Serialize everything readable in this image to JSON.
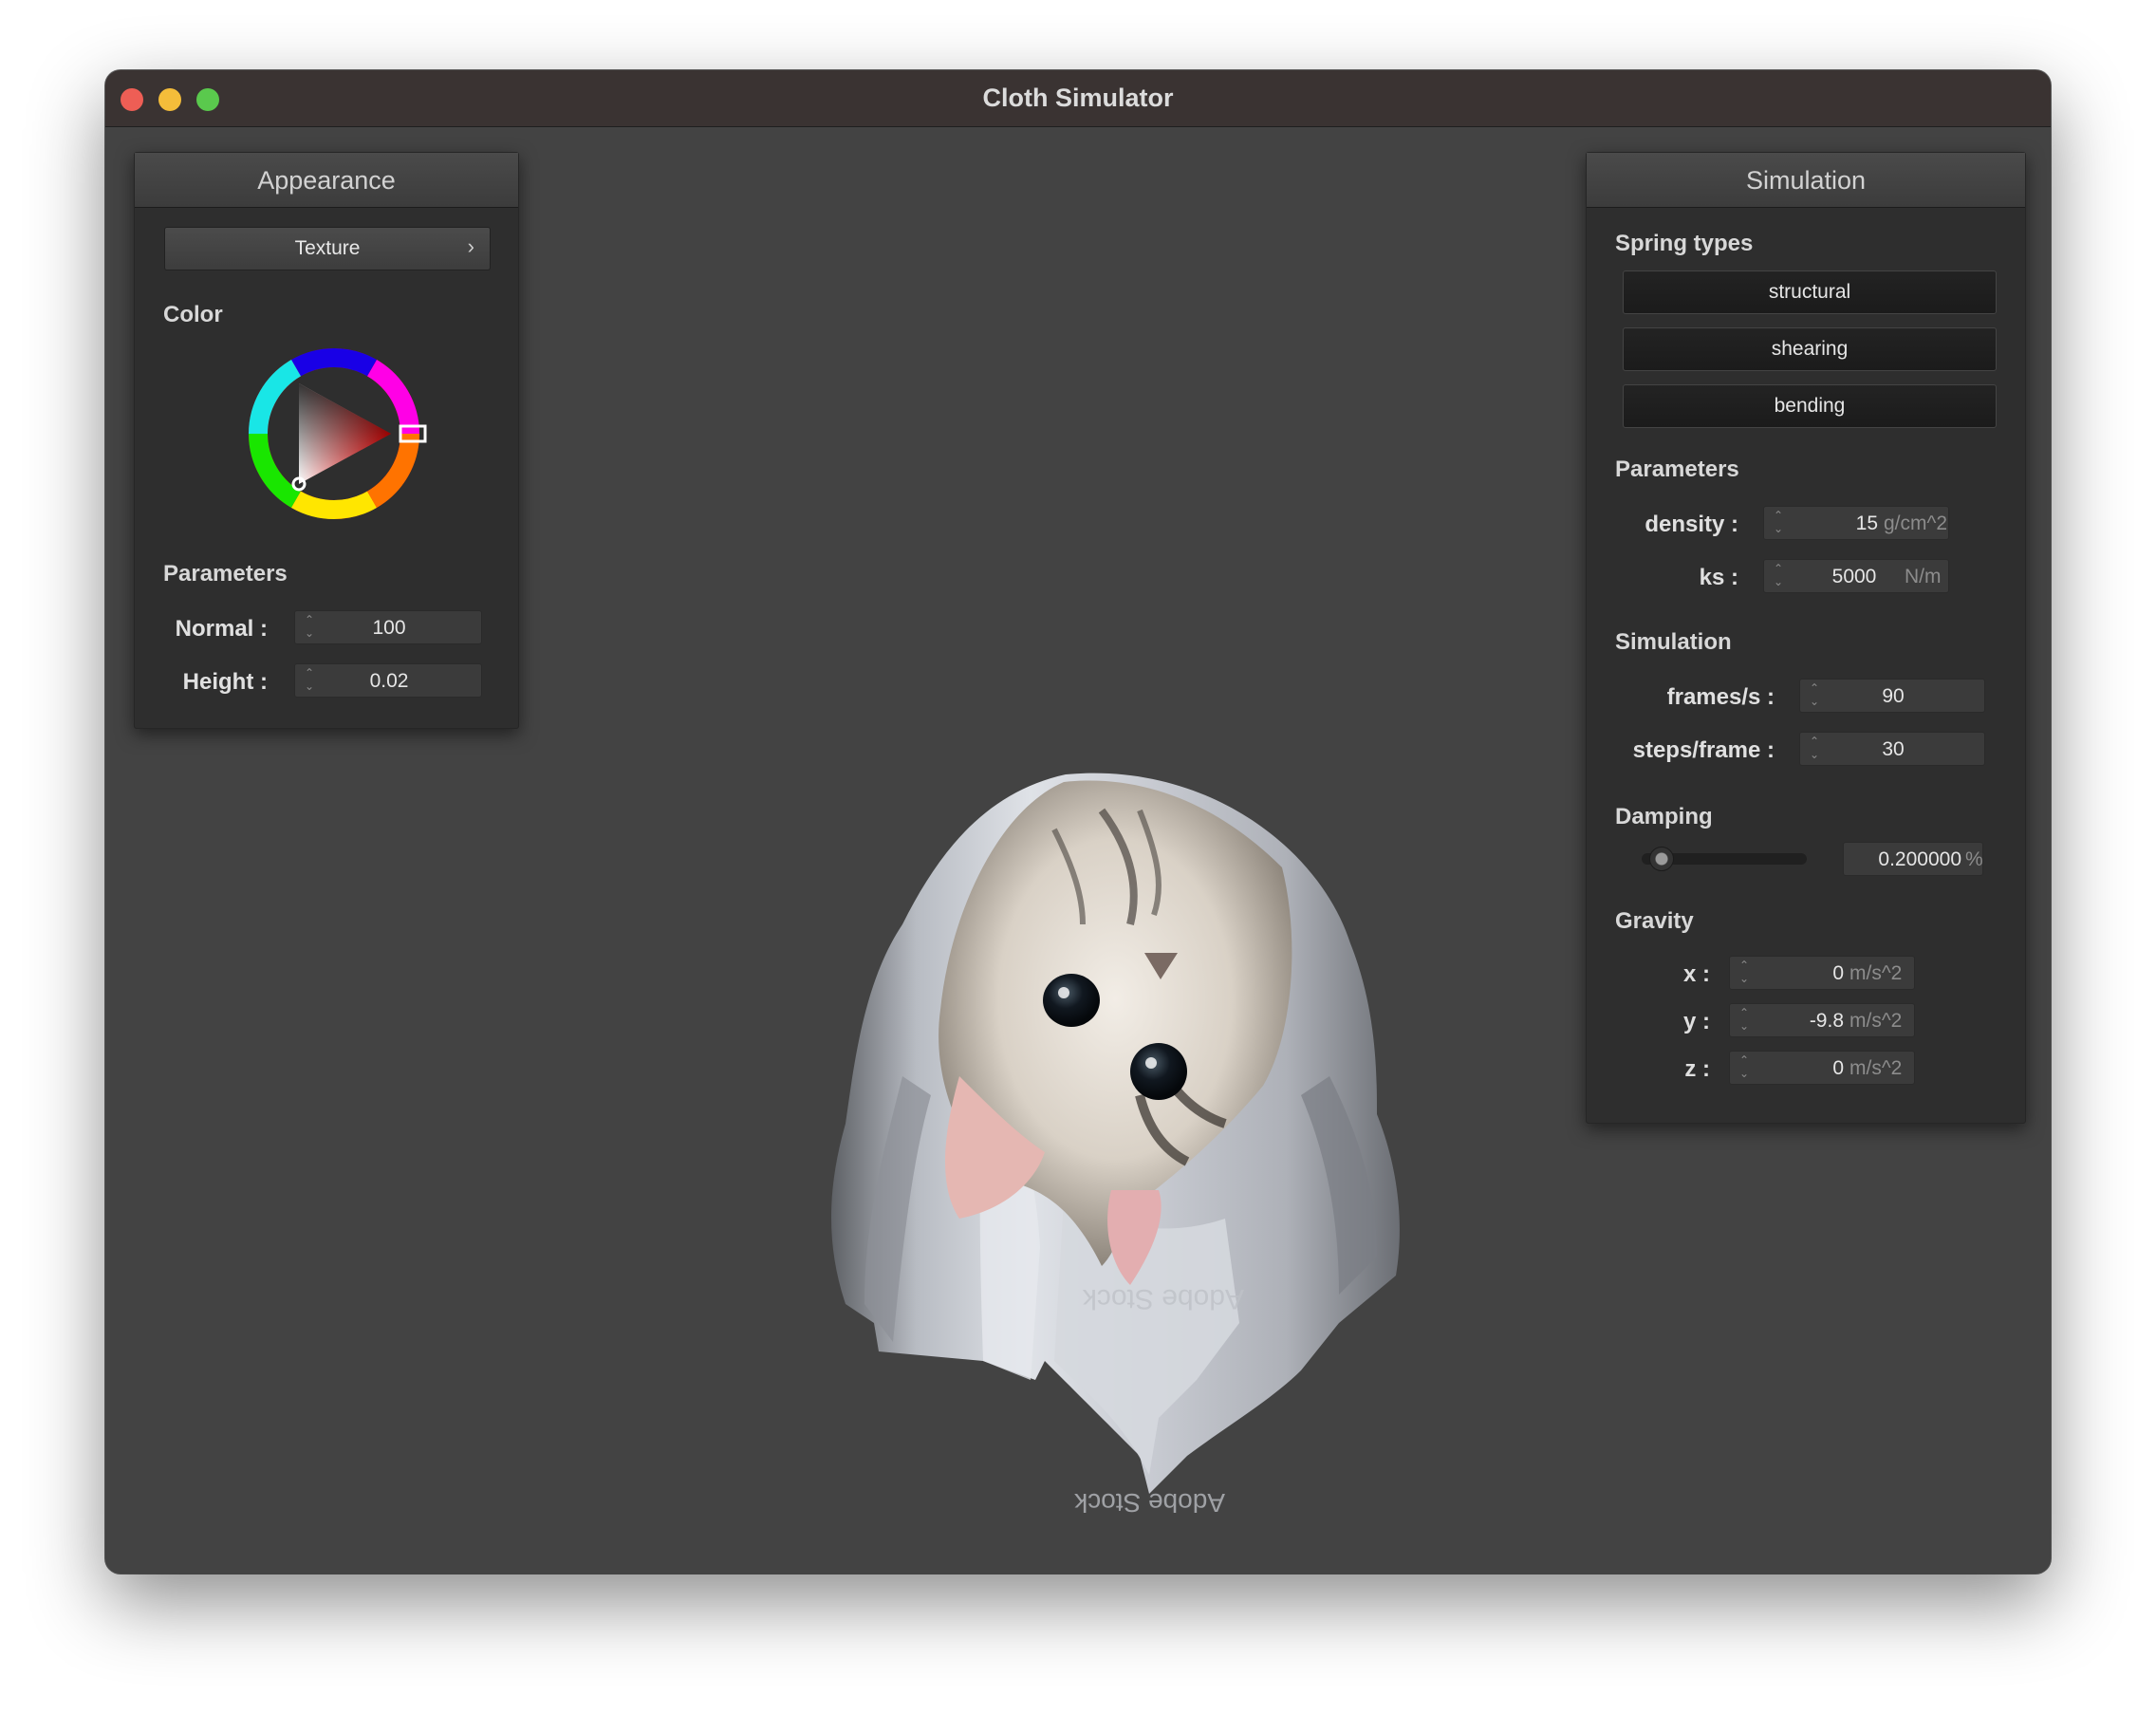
{
  "window": {
    "title": "Cloth Simulator"
  },
  "appearance": {
    "header": "Appearance",
    "texture_label": "Texture",
    "texture_chevron": "›",
    "color_label": "Color",
    "color": {
      "hue": "#ff0000",
      "selected": "#ff0000"
    },
    "params_label": "Parameters",
    "normal": {
      "label": "Normal :",
      "value": "100"
    },
    "height": {
      "label": "Height :",
      "value": "0.02"
    }
  },
  "simulation": {
    "header": "Simulation",
    "spring_label": "Spring types",
    "springs": [
      "structural",
      "shearing",
      "bending"
    ],
    "params_label": "Parameters",
    "density": {
      "label": "density :",
      "value": "15",
      "unit": "g/cm^2"
    },
    "ks": {
      "label": "ks :",
      "value": "5000",
      "unit": "N/m"
    },
    "sim_label": "Simulation",
    "fps": {
      "label": "frames/s :",
      "value": "90"
    },
    "steps": {
      "label": "steps/frame :",
      "value": "30"
    },
    "damping_label": "Damping",
    "damping": {
      "value": "0.200000",
      "unit": "%",
      "level": 0.2
    },
    "gravity_label": "Gravity",
    "gx": {
      "label": "x :",
      "value": "0",
      "unit": "m/s^2"
    },
    "gy": {
      "label": "y :",
      "value": "-9.8",
      "unit": "m/s^2"
    },
    "gz": {
      "label": "z :",
      "value": "0",
      "unit": "m/s^2"
    }
  },
  "cloth": {
    "watermark": "Adobe Stock"
  }
}
